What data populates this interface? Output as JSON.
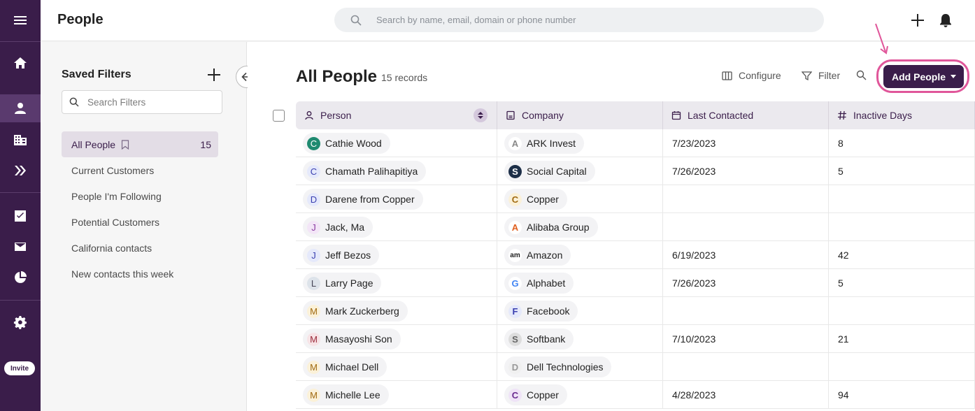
{
  "rail": {
    "invite_label": "Invite",
    "icons": [
      "menu-icon",
      "home-icon",
      "person-icon",
      "building-icon",
      "chevrons-icon",
      "checkbox-icon",
      "mail-icon",
      "pie-chart-icon",
      "gear-icon"
    ]
  },
  "header": {
    "title": "People",
    "search_placeholder": "Search by name, email, domain or phone number"
  },
  "filters": {
    "title": "Saved Filters",
    "search_placeholder": "Search Filters",
    "items": [
      {
        "label": "All People",
        "count": "15"
      },
      {
        "label": "Current Customers"
      },
      {
        "label": "People I'm Following"
      },
      {
        "label": "Potential Customers"
      },
      {
        "label": "California contacts"
      },
      {
        "label": "New contacts this week"
      }
    ]
  },
  "main": {
    "title": "All People",
    "records": "15 records",
    "configure_label": "Configure",
    "filter_label": "Filter",
    "add_label": "Add People",
    "columns": [
      "Person",
      "Company",
      "Last Contacted",
      "Inactive Days"
    ],
    "rows": [
      {
        "person": "Cathie Wood",
        "initial": "C",
        "company": "ARK Invest",
        "co_initial": "A",
        "last": "7/23/2023",
        "days": "8"
      },
      {
        "person": "Chamath Palihapitiya",
        "initial": "C",
        "company": "Social Capital",
        "co_initial": "S",
        "last": "7/26/2023",
        "days": "5"
      },
      {
        "person": "Darene from Copper",
        "initial": "D",
        "company": "Copper",
        "co_initial": "C",
        "last": "",
        "days": ""
      },
      {
        "person": "Jack, Ma",
        "initial": "J",
        "company": "Alibaba Group",
        "co_initial": "A",
        "last": "",
        "days": ""
      },
      {
        "person": "Jeff Bezos",
        "initial": "J",
        "company": "Amazon",
        "co_initial": "am",
        "last": "6/19/2023",
        "days": "42"
      },
      {
        "person": "Larry Page",
        "initial": "L",
        "company": "Alphabet",
        "co_initial": "G",
        "last": "7/26/2023",
        "days": "5"
      },
      {
        "person": "Mark Zuckerberg",
        "initial": "M",
        "company": "Facebook",
        "co_initial": "F",
        "last": "",
        "days": ""
      },
      {
        "person": "Masayoshi Son",
        "initial": "M",
        "company": "Softbank",
        "co_initial": "S",
        "last": "7/10/2023",
        "days": "21"
      },
      {
        "person": "Michael Dell",
        "initial": "M",
        "company": "Dell Technologies",
        "co_initial": "D",
        "last": "",
        "days": ""
      },
      {
        "person": "Michelle Lee",
        "initial": "M",
        "company": "Copper",
        "co_initial": "C",
        "last": "4/28/2023",
        "days": "94"
      }
    ]
  },
  "colors": {
    "brand": "#3a1d4a",
    "highlight": "#e0569a"
  }
}
